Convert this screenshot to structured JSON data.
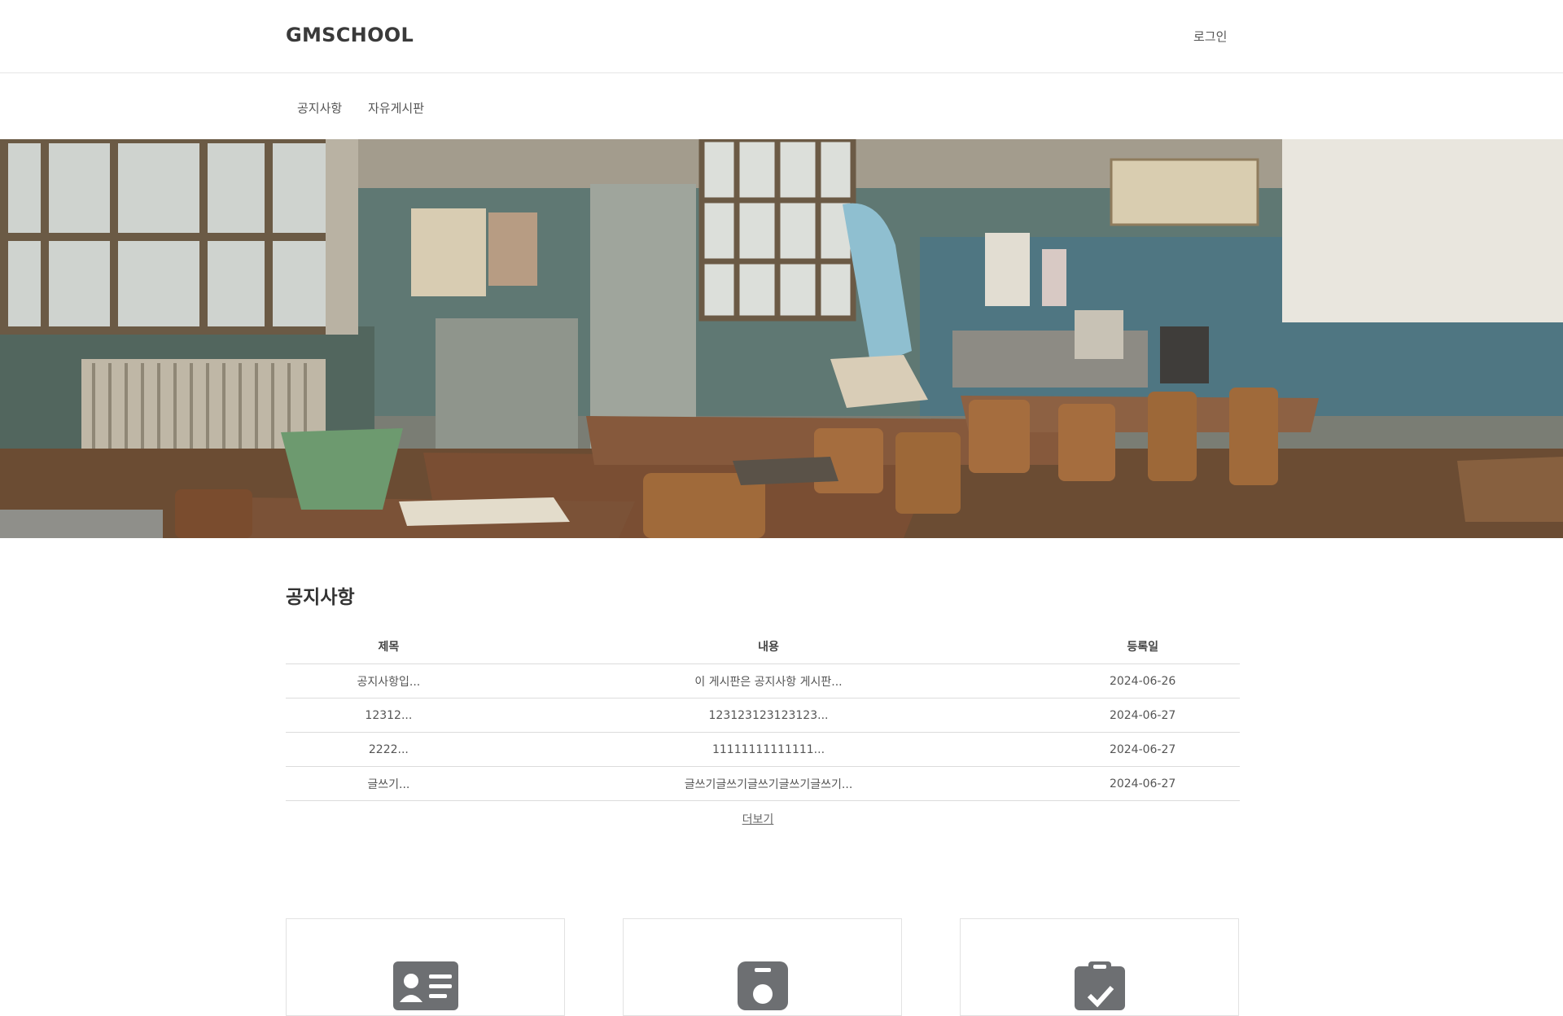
{
  "header": {
    "logo": "GMSCHOOL",
    "login_label": "로그인"
  },
  "nav": {
    "items": [
      {
        "label": "공지사항"
      },
      {
        "label": "자유게시판"
      }
    ]
  },
  "hero": {
    "image": "classroom-photo"
  },
  "notice": {
    "title": "공지사항",
    "columns": [
      "제목",
      "내용",
      "등록일"
    ],
    "rows": [
      {
        "title": "공지사항입...",
        "content": "이 게시판은 공지사항 게시판...",
        "date": "2024-06-26"
      },
      {
        "title": "12312...",
        "content": "123123123123123...",
        "date": "2024-06-27"
      },
      {
        "title": "2222...",
        "content": "11111111111111...",
        "date": "2024-06-27"
      },
      {
        "title": "글쓰기...",
        "content": "글쓰기글쓰기글쓰기글쓰기글쓰기...",
        "date": "2024-06-27"
      }
    ],
    "more_label": "더보기"
  },
  "cards": [
    {
      "icon": "id-card-icon"
    },
    {
      "icon": "id-badge-icon"
    },
    {
      "icon": "clipboard-check-icon"
    }
  ],
  "colors": {
    "icon_gray": "#6d6f72",
    "border": "#dcdcdc"
  }
}
